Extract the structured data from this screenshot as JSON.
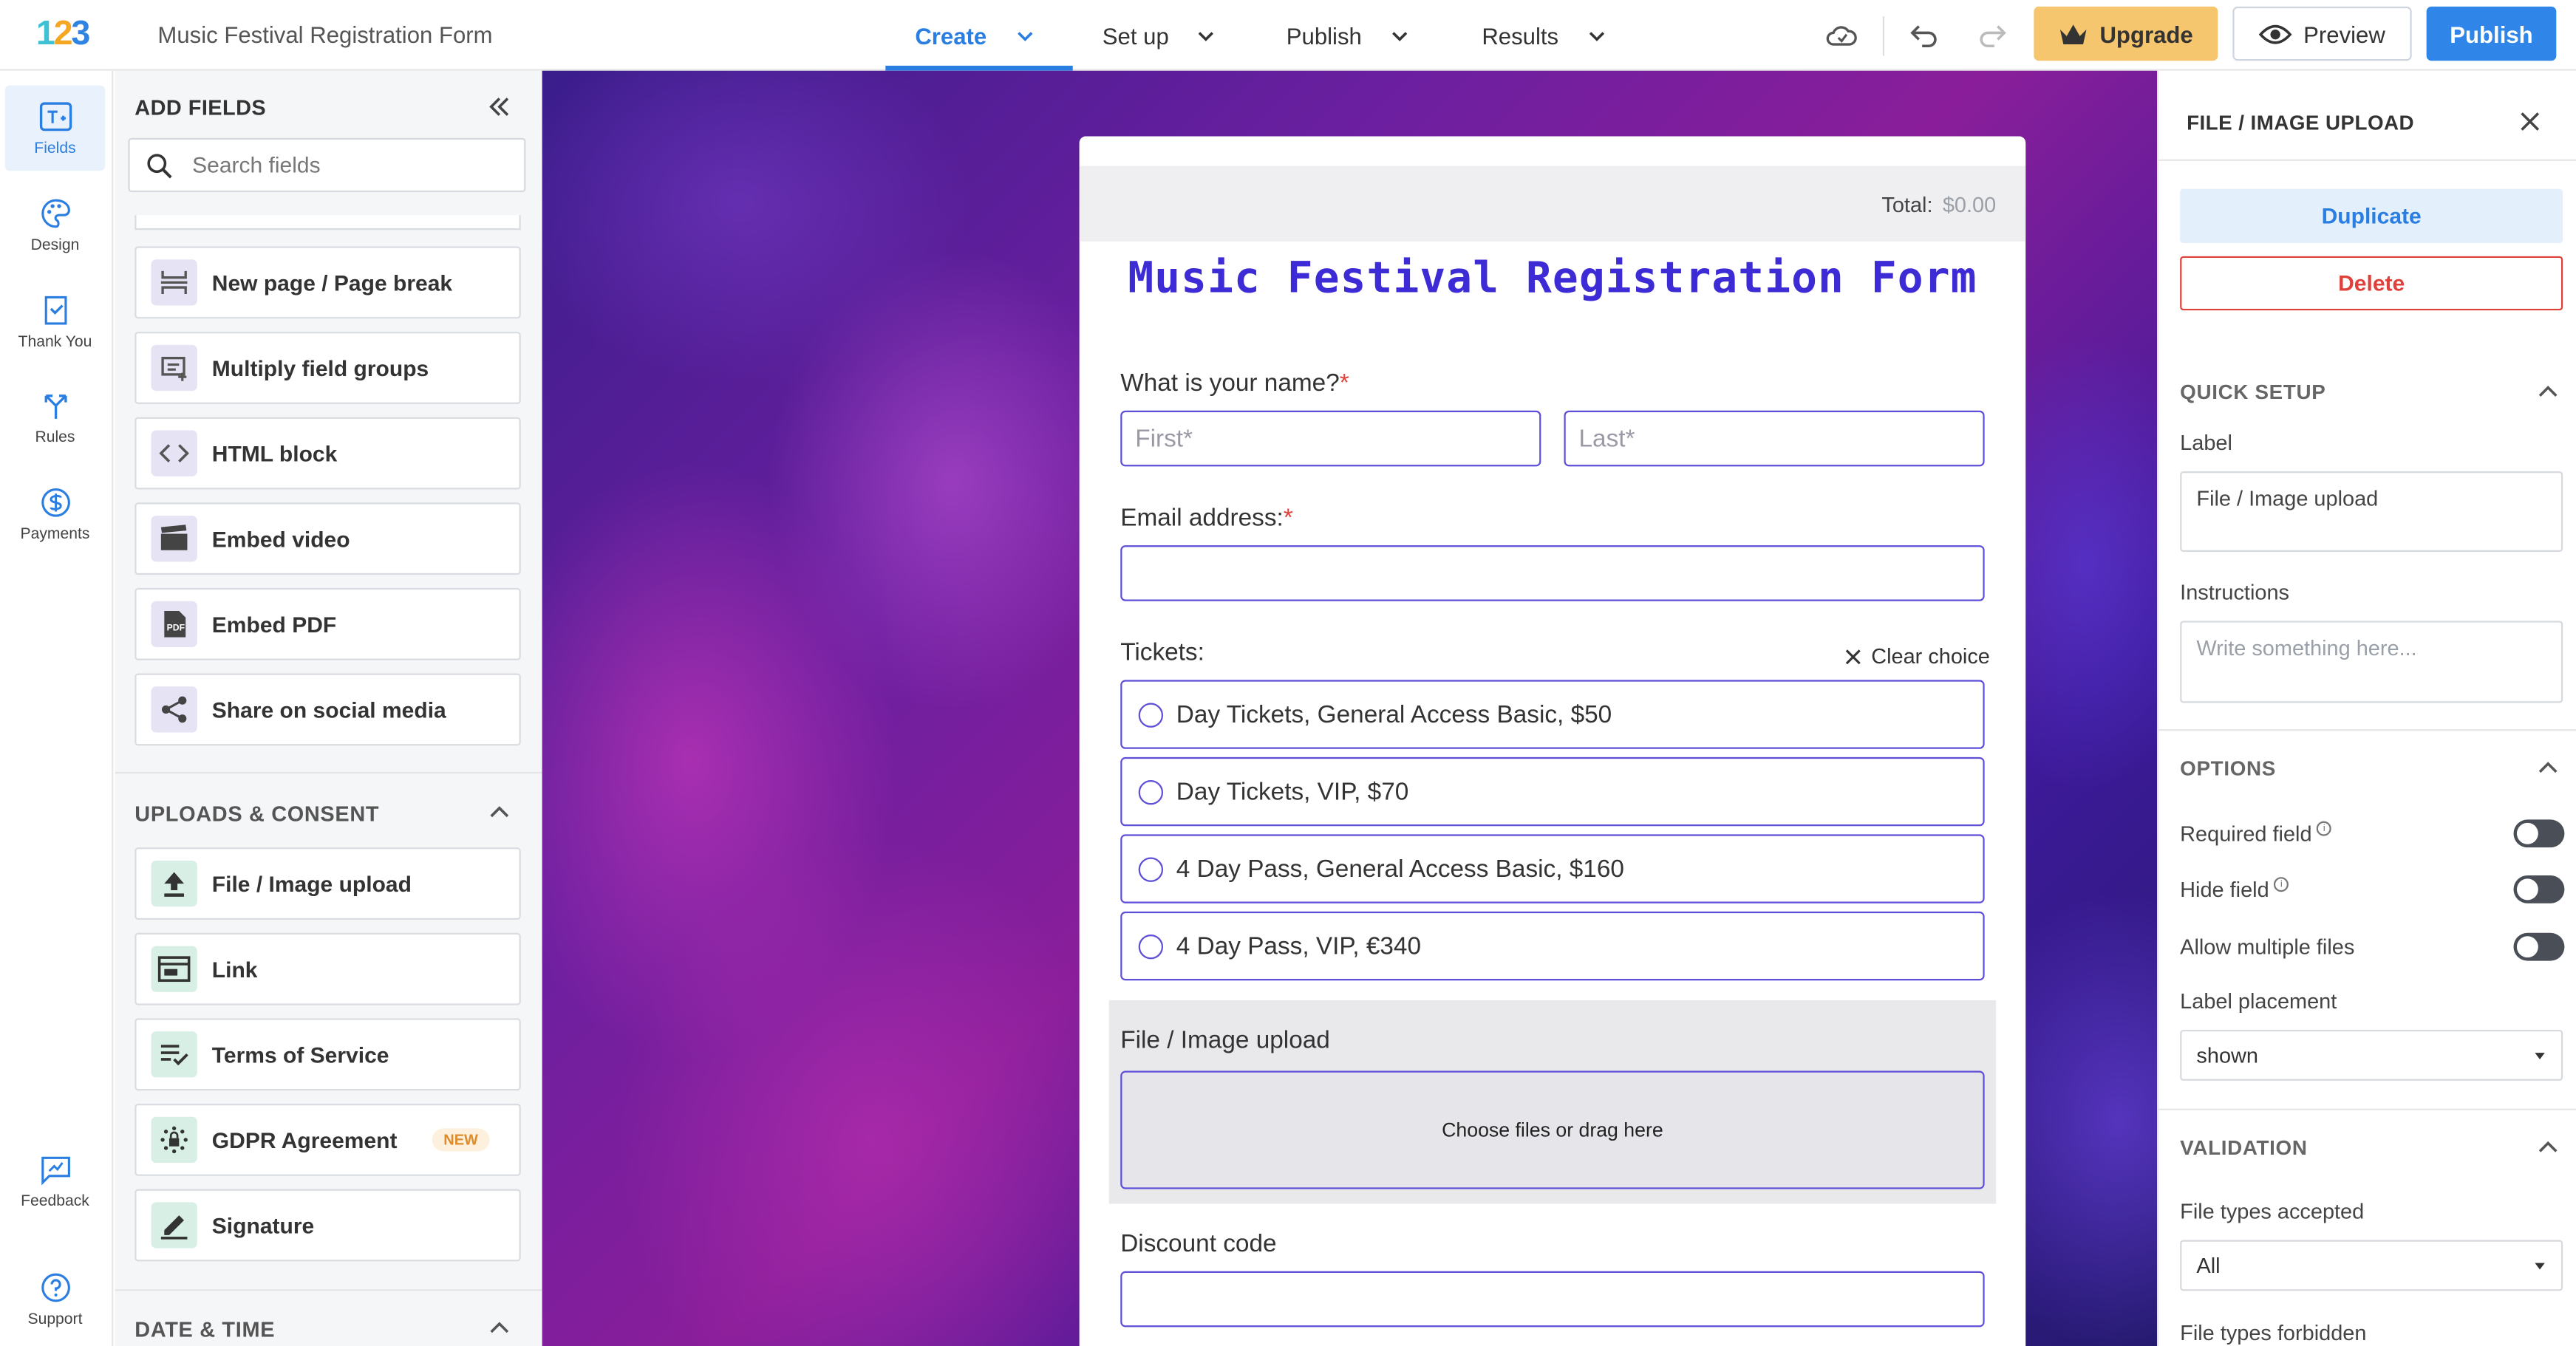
{
  "app": {
    "logo": {
      "p1": "1",
      "p2": "2",
      "p3": "3"
    },
    "form_title": "Music Festival Registration Form"
  },
  "nav": {
    "tabs": [
      {
        "label": "Create",
        "active": true
      },
      {
        "label": "Set up",
        "active": false
      },
      {
        "label": "Publish",
        "active": false
      },
      {
        "label": "Results",
        "active": false
      }
    ],
    "upgrade": "Upgrade",
    "preview": "Preview",
    "publish": "Publish"
  },
  "rail": {
    "items": [
      {
        "label": "Fields",
        "icon": "fields-icon",
        "active": true
      },
      {
        "label": "Design",
        "icon": "palette-icon"
      },
      {
        "label": "Thank You",
        "icon": "thank-you-icon"
      },
      {
        "label": "Rules",
        "icon": "rules-icon"
      },
      {
        "label": "Payments",
        "icon": "dollar-icon"
      },
      {
        "label": "Feedback",
        "icon": "feedback-icon"
      },
      {
        "label": "Support",
        "icon": "help-icon"
      }
    ]
  },
  "fields_panel": {
    "title": "ADD FIELDS",
    "search_placeholder": "Search fields",
    "layout_items": [
      {
        "label": "New page / Page break",
        "icon": "page-break-icon"
      },
      {
        "label": "Multiply field groups",
        "icon": "field-groups-icon"
      },
      {
        "label": "HTML block",
        "icon": "code-icon"
      },
      {
        "label": "Embed video",
        "icon": "video-icon"
      },
      {
        "label": "Embed PDF",
        "icon": "pdf-icon"
      },
      {
        "label": "Share on social media",
        "icon": "share-icon"
      }
    ],
    "uploads_section": "UPLOADS & CONSENT",
    "upload_items": [
      {
        "label": "File / Image upload",
        "icon": "upload-icon"
      },
      {
        "label": "Link",
        "icon": "link-icon"
      },
      {
        "label": "Terms of Service",
        "icon": "terms-icon"
      },
      {
        "label": "GDPR Agreement",
        "icon": "gdpr-icon",
        "badge": "NEW"
      },
      {
        "label": "Signature",
        "icon": "signature-icon"
      }
    ],
    "date_section": "DATE & TIME"
  },
  "form": {
    "total_label": "Total:",
    "total_value": "$0.00",
    "title": "Music Festival Registration Form",
    "name_label": "What is your name?",
    "first_placeholder": "First*",
    "last_placeholder": "Last*",
    "email_label": "Email address:",
    "tickets_label": "Tickets:",
    "clear_choice": "Clear choice",
    "ticket_options": [
      "Day Tickets, General Access Basic, $50",
      "Day Tickets, VIP, $70",
      "4 Day Pass, General Access Basic, $160",
      "4 Day Pass, VIP, €340"
    ],
    "upload_label": "File / Image upload",
    "upload_drop": "Choose files or drag here",
    "discount_label": "Discount code",
    "required_mark": "*"
  },
  "props": {
    "title": "FILE / IMAGE UPLOAD",
    "duplicate": "Duplicate",
    "delete": "Delete",
    "quick_setup": "QUICK SETUP",
    "label_label": "Label",
    "label_value": "File / Image upload",
    "instructions_label": "Instructions",
    "instructions_placeholder": "Write something here...",
    "options": "OPTIONS",
    "required_field": "Required field",
    "hide_field": "Hide field",
    "allow_multiple": "Allow multiple files",
    "label_placement": "Label placement",
    "label_placement_value": "shown",
    "validation": "VALIDATION",
    "types_accepted": "File types accepted",
    "types_accepted_value": "All",
    "types_forbidden": "File types forbidden"
  },
  "colors": {
    "accent": "#2a7de1",
    "form_title": "#3d2bd6",
    "input_border": "#5e4fd8",
    "upgrade": "#f5c66e",
    "danger": "#e0403a"
  }
}
